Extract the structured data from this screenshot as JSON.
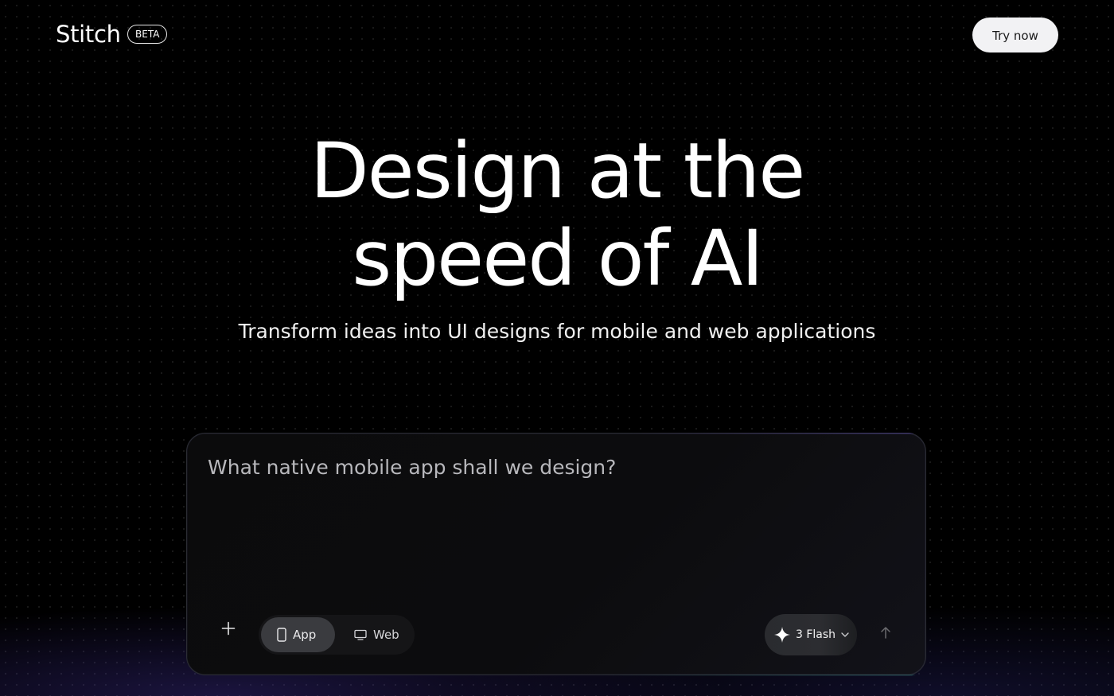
{
  "header": {
    "logo": "Stitch",
    "badge": "BETA",
    "cta_label": "Try now"
  },
  "hero": {
    "title_line1": "Design at the",
    "title_line2": "speed of AI",
    "subtitle": "Transform ideas into UI designs for mobile and web applications"
  },
  "prompt": {
    "placeholder": "What native mobile app shall we design?",
    "value": "",
    "add_icon": "plus-icon",
    "modes": [
      {
        "label": "App",
        "icon": "phone-icon",
        "selected": true
      },
      {
        "label": "Web",
        "icon": "monitor-icon",
        "selected": false
      }
    ],
    "model": {
      "label": "3 Flash",
      "icon": "sparkle-icon"
    },
    "send_icon": "arrow-up-icon"
  }
}
